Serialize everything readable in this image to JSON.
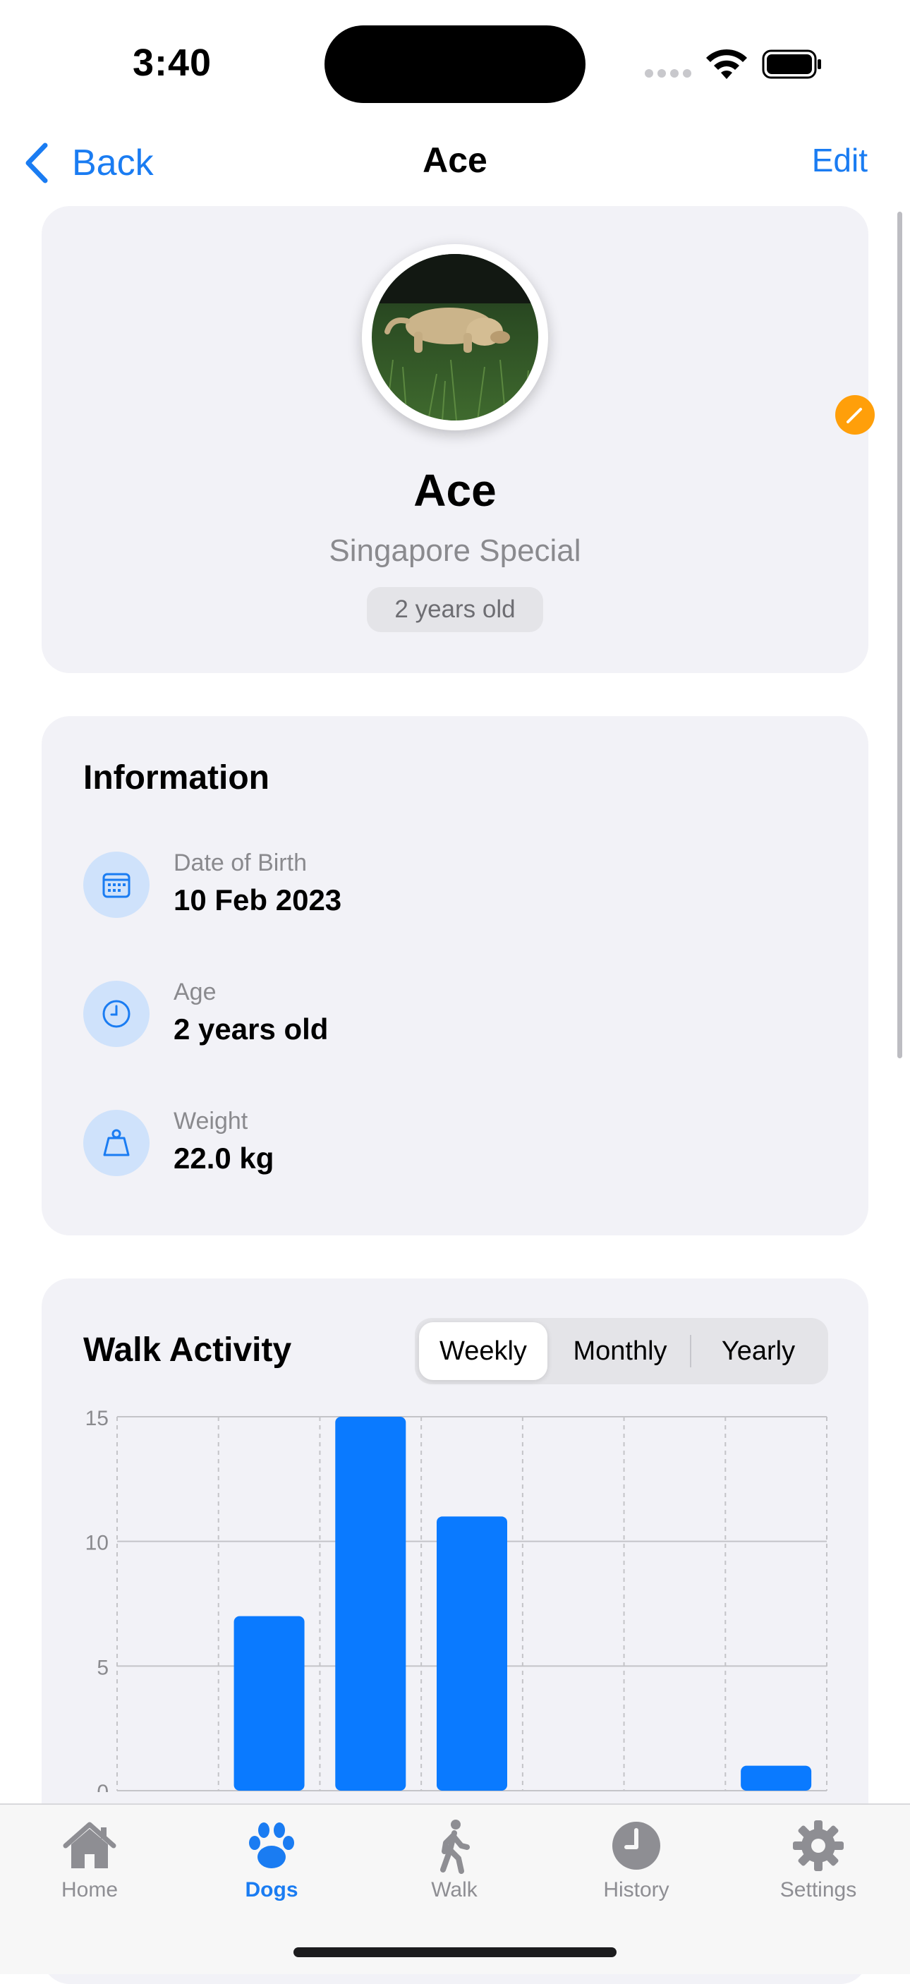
{
  "status": {
    "time": "3:40"
  },
  "nav": {
    "back_label": "Back",
    "title": "Ace",
    "edit_label": "Edit"
  },
  "profile": {
    "name": "Ace",
    "breed": "Singapore Special",
    "age_badge": "2 years old"
  },
  "information": {
    "title": "Information",
    "items": [
      {
        "icon": "calendar-icon",
        "label": "Date of Birth",
        "value": "10 Feb 2023"
      },
      {
        "icon": "clock-icon",
        "label": "Age",
        "value": "2 years old"
      },
      {
        "icon": "weight-icon",
        "label": "Weight",
        "value": "22.0 kg"
      }
    ]
  },
  "activity": {
    "title": "Walk Activity",
    "segments": [
      "Weekly",
      "Monthly",
      "Yearly"
    ],
    "selected_segment": "Weekly"
  },
  "chart_data": {
    "type": "bar",
    "categories": [
      "",
      "",
      "",
      "",
      "",
      "",
      ""
    ],
    "values": [
      0,
      7,
      15,
      11,
      0,
      0,
      1
    ],
    "ylim": [
      0,
      15
    ],
    "yticks": [
      0,
      5,
      10,
      15
    ],
    "grid": true,
    "bar_color": "#0a7aff"
  },
  "tabs": [
    {
      "label": "Home",
      "icon": "house-icon"
    },
    {
      "label": "Dogs",
      "icon": "paw-icon"
    },
    {
      "label": "Walk",
      "icon": "walking-person-icon"
    },
    {
      "label": "History",
      "icon": "clock-icon"
    },
    {
      "label": "Settings",
      "icon": "gear-icon"
    }
  ],
  "active_tab": "Dogs",
  "colors": {
    "accent": "#1a7cf2",
    "card_bg": "#f2f2f7",
    "icon_bg": "#cfe2fb",
    "badge": "#ff9f0a"
  }
}
